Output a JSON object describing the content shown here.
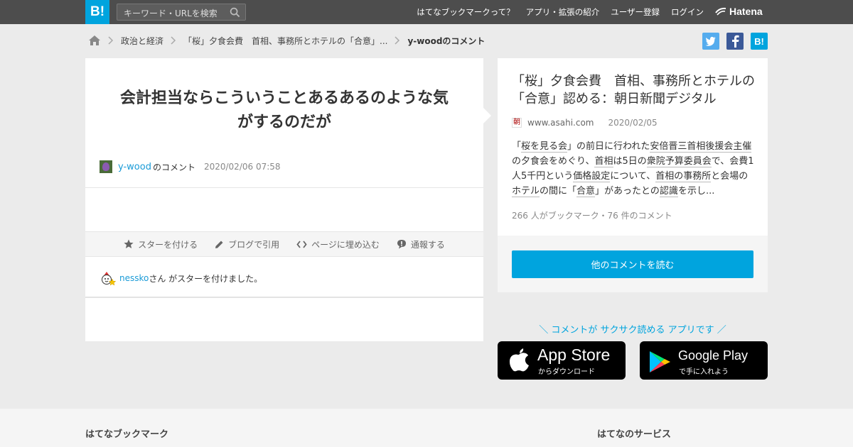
{
  "header": {
    "logo": "B!",
    "search_placeholder": "キーワード・URLを検索",
    "nav": [
      "はてなブックマークって？",
      "アプリ・拡張の紹介",
      "ユーザー登録",
      "ログイン"
    ],
    "brand": "Hatena"
  },
  "breadcrumb": {
    "items": [
      "政治と経済",
      "「桜」夕食会費　首相、事務所とホテルの「合意」...",
      "y-woodのコメント"
    ]
  },
  "share": {
    "twitter": "twitter-icon",
    "facebook": "facebook-icon",
    "hatena": "B!"
  },
  "comment": {
    "text": "会計担当ならこういうことあるあるのような気がするのだが",
    "user": "y-wood",
    "label": "のコメント",
    "date": "2020/02/06 07:58"
  },
  "actions": [
    "スターを付ける",
    "ブログで引用",
    "ページに埋め込む",
    "通報する"
  ],
  "star": {
    "user": "nessko",
    "text": "さん がスターを付けました。"
  },
  "entry": {
    "title": "「桜」夕食会費　首相、事務所とホテルの「合意」認める：朝日新聞デジタル",
    "domain": "www.asahi.com",
    "date": "2020/02/05",
    "summary": [
      {
        "t": "「",
        "u": false
      },
      {
        "t": "桜を見る会",
        "u": true
      },
      {
        "t": "」の前日に行われた",
        "u": false
      },
      {
        "t": "安倍晋三首相後援会主催",
        "u": true
      },
      {
        "t": "の夕食会をめぐり、",
        "u": false
      },
      {
        "t": "首相",
        "u": true
      },
      {
        "t": "は5日の",
        "u": false
      },
      {
        "t": "衆院予算委員会",
        "u": true
      },
      {
        "t": "で、会費1人5千円という",
        "u": false
      },
      {
        "t": "価格設定",
        "u": true
      },
      {
        "t": "について、",
        "u": false
      },
      {
        "t": "首相の事務所",
        "u": true
      },
      {
        "t": "と会場の",
        "u": false
      },
      {
        "t": "ホテル",
        "u": true
      },
      {
        "t": "の間に「",
        "u": false
      },
      {
        "t": "合意",
        "u": true
      },
      {
        "t": "」があったとの",
        "u": false
      },
      {
        "t": "認識",
        "u": true
      },
      {
        "t": "を示し...",
        "u": false
      }
    ],
    "count": "266 人がブックマーク・76 件のコメント",
    "button": "他のコメントを読む"
  },
  "app": {
    "promo": "＼ コメントが サクサク読める アプリです ／",
    "appstore_main": "App Store",
    "appstore_sub": "からダウンロード",
    "googleplay_main": "Google Play",
    "googleplay_sub": "で手に入れよう"
  },
  "footer": {
    "left": "はてなブックマーク",
    "right": "はてなのサービス"
  },
  "colors": {
    "accent": "#00a4de",
    "topbar": "#4d4d4d",
    "twitter": "#55acee",
    "facebook": "#3b5998"
  }
}
